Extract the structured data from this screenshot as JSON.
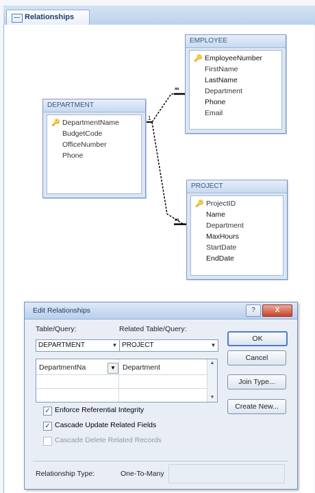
{
  "window": {
    "tab_label": "Relationships"
  },
  "tables": {
    "employee": {
      "title": "EMPLOYEE",
      "fields": [
        "EmployeeNumber",
        "FirstName",
        "LastName",
        "Department",
        "Phone",
        "Email"
      ],
      "key_field": "EmployeeNumber"
    },
    "department": {
      "title": "DEPARTMENT",
      "fields": [
        "DepartmentName",
        "BudgetCode",
        "OfficeNumber",
        "Phone"
      ],
      "key_field": "DepartmentName"
    },
    "project": {
      "title": "PROJECT",
      "fields": [
        "ProjectID",
        "Name",
        "Department",
        "MaxHours",
        "StartDate",
        "EndDate"
      ],
      "key_field": "ProjectID"
    }
  },
  "relationships": {
    "one_symbol": "1",
    "many_symbol": "∞"
  },
  "dialog": {
    "title": "Edit Relationships",
    "help_label": "?",
    "close_label": "X",
    "table_query_label": "Table/Query:",
    "related_table_query_label": "Related Table/Query:",
    "table_query_value": "DEPARTMENT",
    "related_table_query_value": "PROJECT",
    "grid_left_value": "DepartmentNa",
    "grid_right_value": "Department",
    "buttons": {
      "ok": "OK",
      "cancel": "Cancel",
      "join_type": "Join Type...",
      "create_new": "Create New..."
    },
    "checkboxes": {
      "enforce": "Enforce Referential Integrity",
      "cascade_update": "Cascade Update Related Fields",
      "cascade_delete": "Cascade Delete Related Records"
    },
    "checked": {
      "enforce": true,
      "cascade_update": true,
      "cascade_delete": false
    },
    "relationship_type_label": "Relationship Type:",
    "relationship_type_value": "One-To-Many"
  },
  "icons": {
    "key": "key-icon",
    "tab": "relationships-tab-icon",
    "dropdown": "chevron-down-icon"
  },
  "colors": {
    "accent": "#4d7cc7",
    "close": "#c8432b"
  }
}
